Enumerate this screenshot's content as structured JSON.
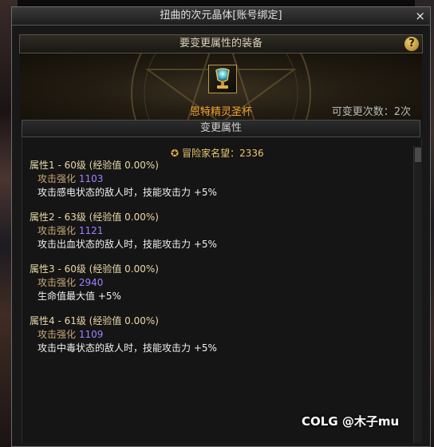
{
  "window": {
    "title": "扭曲的次元晶体[账号绑定]",
    "close_icon": "×"
  },
  "equipment_header": {
    "title": "要变更属性的装备",
    "help_icon": "?"
  },
  "item": {
    "name": "恩特精灵圣杯",
    "change_count": "可变更次数：2次"
  },
  "attributes_header": {
    "title": "变更属性"
  },
  "renown": {
    "icon": "✪",
    "text": "冒险家名望：2336"
  },
  "attributes": [
    {
      "title": "属性1 - 60级 (经验值 0.00%)",
      "stat_label": "攻击强化",
      "stat_value": "1103",
      "effect": "攻击感电状态的敌人时，技能攻击力 +5%"
    },
    {
      "title": "属性2 - 63级 (经验值 0.00%)",
      "stat_label": "攻击强化",
      "stat_value": "1121",
      "effect": "攻击出血状态的敌人时，技能攻击力 +5%"
    },
    {
      "title": "属性3 - 60级 (经验值 0.00%)",
      "stat_label": "攻击强化",
      "stat_value": "2940",
      "effect": "生命值最大值 +5%"
    },
    {
      "title": "属性4 - 61级 (经验值 0.00%)",
      "stat_label": "攻击强化",
      "stat_value": "1109",
      "effect": "攻击中毒状态的敌人时，技能攻击力 +5%"
    }
  ],
  "watermark": "COLG @木子mu"
}
